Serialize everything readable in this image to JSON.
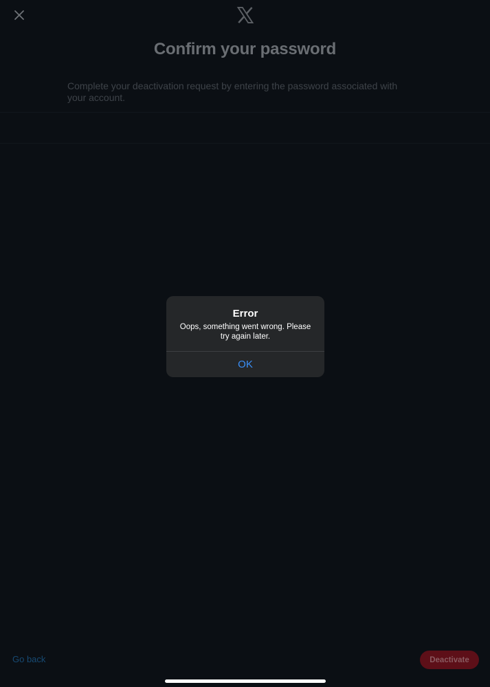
{
  "header": {
    "close_icon": "close-icon",
    "logo_icon": "x-logo-icon"
  },
  "main": {
    "title": "Confirm your password",
    "description": "Complete your deactivation request by entering the password associated with your account.",
    "password_field": {
      "value": "",
      "placeholder": ""
    }
  },
  "dialog": {
    "title": "Error",
    "message": "Oops, something went wrong. Please try again later.",
    "ok_label": "OK"
  },
  "footer": {
    "go_back_label": "Go back",
    "deactivate_label": "Deactivate"
  },
  "colors": {
    "background": "#0b0f14",
    "dialog_bg": "#252729",
    "ok_blue": "#3a8ff7",
    "deactivate_red": "#5d0f18"
  }
}
